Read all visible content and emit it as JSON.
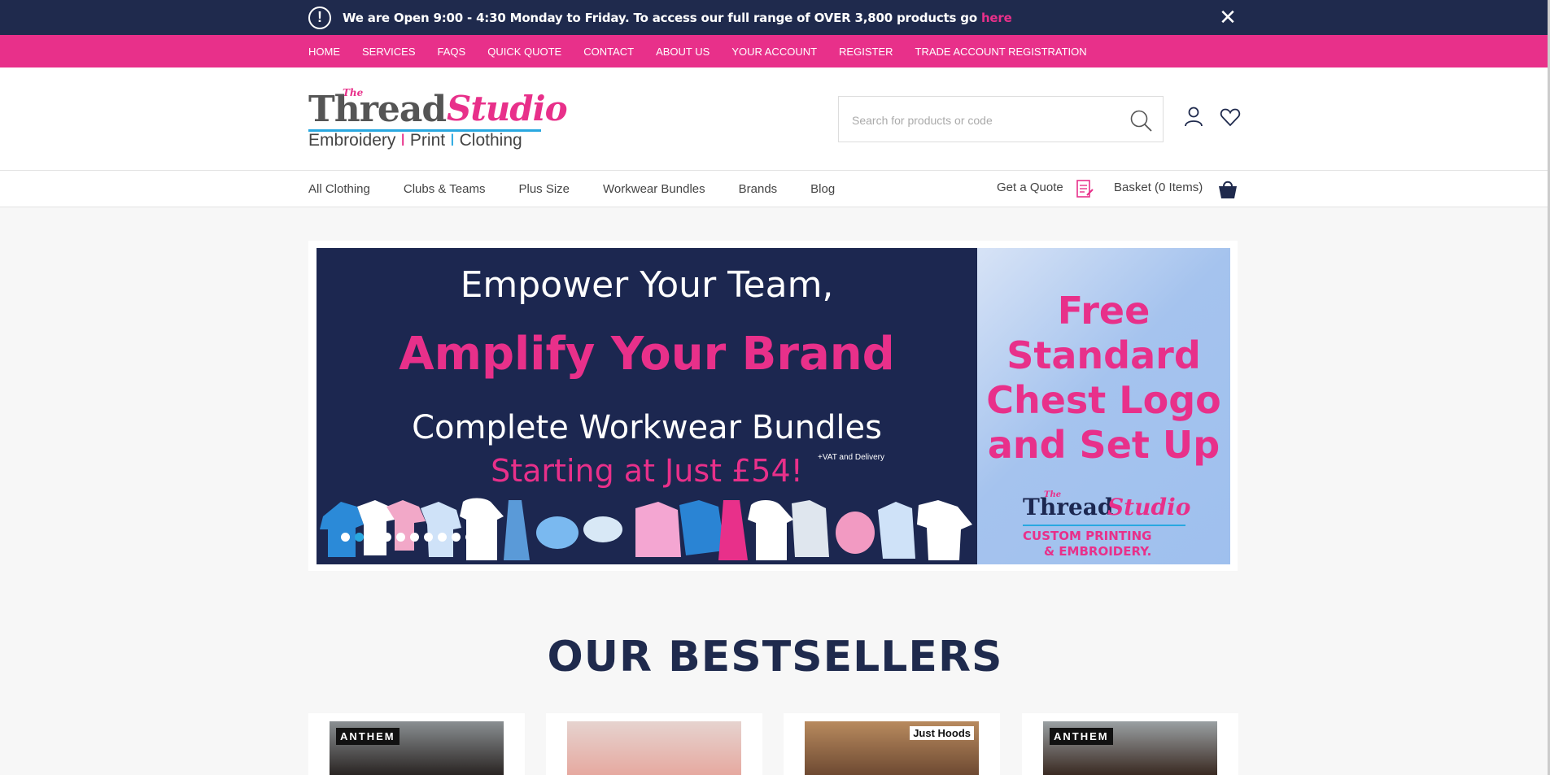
{
  "announcement": {
    "text": "We are Open 9:00 - 4:30 Monday to Friday. To access our full range of OVER 3,800 products go ",
    "link": "here",
    "close": "✕",
    "alert_glyph": "!"
  },
  "top_nav": [
    "HOME",
    "SERVICES",
    "FAQS",
    "QUICK QUOTE",
    "CONTACT",
    "ABOUT US",
    "YOUR ACCOUNT",
    "REGISTER",
    "TRADE ACCOUNT REGISTRATION"
  ],
  "logo": {
    "the": "The",
    "thread": "Thread",
    "studio": "Studio",
    "tag_1": "Embroidery",
    "sep": "I",
    "tag_2": "Print",
    "tag_3": "Clothing"
  },
  "search": {
    "placeholder": "Search for products or code",
    "value": ""
  },
  "main_nav": [
    "All Clothing",
    "Clubs & Teams",
    "Plus Size",
    "Workwear Bundles",
    "Brands",
    "Blog"
  ],
  "quote_label": "Get a Quote",
  "basket_label": "Basket (0 Items)",
  "banner": {
    "line1": "Empower Your Team,",
    "line2": "Amplify Your Brand",
    "line3": "Complete Workwear Bundles",
    "line4": "Starting at Just £54!",
    "vat_note": "+VAT and Delivery",
    "dot_count": 10,
    "active_dot": 1
  },
  "promo": {
    "line1": "Free",
    "line2": "Standard",
    "line3": "Chest Logo",
    "line4": "and Set Up",
    "logo_the": "The",
    "logo_thread": "Thread",
    "logo_studio": "Studio",
    "sub1": "CUSTOM PRINTING",
    "sub2": "& EMBROIDERY."
  },
  "bestsellers": {
    "title": "OUR BESTSELLERS",
    "cards": [
      {
        "brand": "ANTHEM",
        "colors": [
          "#8a8f92",
          "#2a2523"
        ]
      },
      {
        "brand": "",
        "colors": [
          "#e6d3cf",
          "#e6a9a0"
        ]
      },
      {
        "brand": "Just Hoods",
        "colors": [
          "#b88a5e",
          "#6e4a32"
        ]
      },
      {
        "brand": "ANTHEM",
        "colors": [
          "#9aa0a3",
          "#3a2a22"
        ]
      }
    ]
  },
  "colors": {
    "navy": "#1f2a4d",
    "pink": "#e8308a",
    "blue": "#29a8e0"
  }
}
